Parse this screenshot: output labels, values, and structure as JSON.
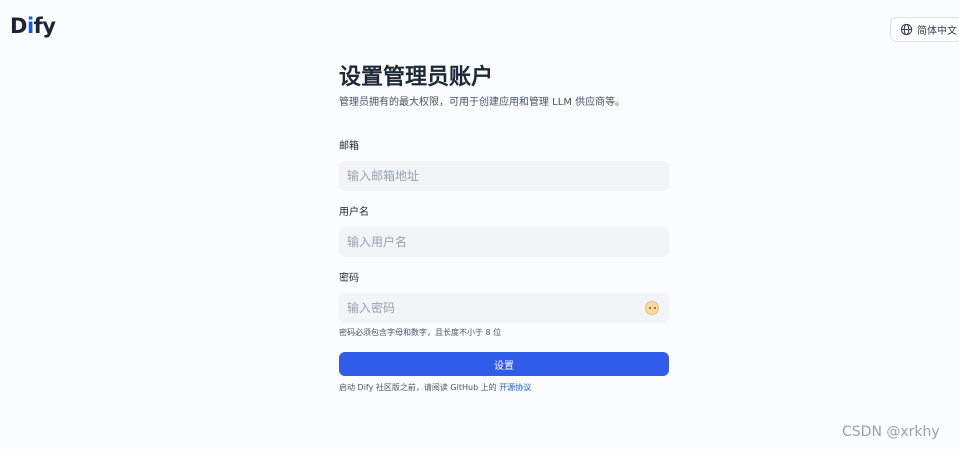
{
  "header": {
    "logo_left": "D",
    "logo_mid": "i",
    "logo_right": "fy",
    "lang_label": "简体中文",
    "lang_icon": "globe-icon"
  },
  "form": {
    "title": "设置管理员账户",
    "subtitle": "管理员拥有的最大权限，可用于创建应用和管理 LLM 供应商等。",
    "email_label": "邮箱",
    "email_placeholder": "输入邮箱地址",
    "email_value": "",
    "username_label": "用户名",
    "username_placeholder": "输入用户名",
    "username_value": "",
    "password_label": "密码",
    "password_placeholder": "输入密码",
    "password_value": "",
    "password_toggle_icon": "eye-toggle-icon",
    "password_hint": "密码必须包含字母和数字，且长度不小于 8 位",
    "submit_label": "设置",
    "agreement_prefix": "启动 Dify 社区版之前，请阅读 GitHub 上的 ",
    "agreement_link": "开源协议"
  },
  "watermark": "CSDN @xrkhy",
  "colors": {
    "accent": "#2f5ce8",
    "background": "#fbfcfd",
    "input_bg": "#f2f4f7"
  }
}
